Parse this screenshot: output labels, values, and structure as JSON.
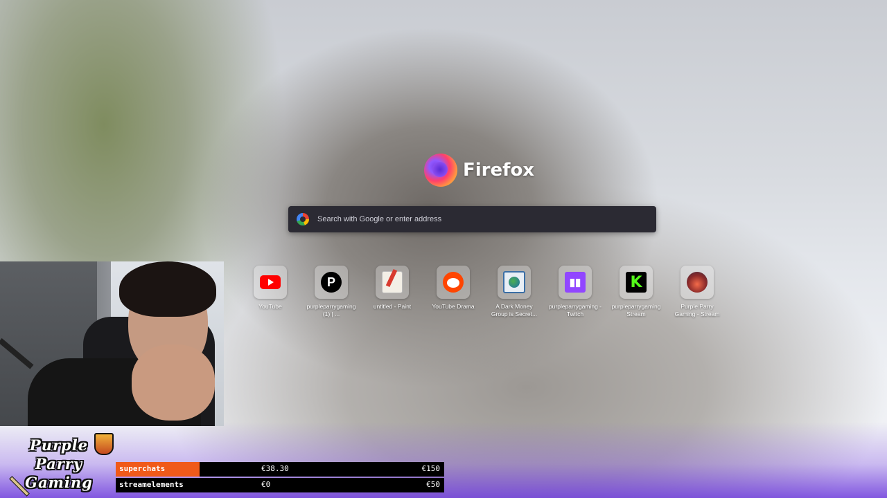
{
  "brand": {
    "name": "Firefox",
    "logo_icon": "firefox-logo-icon"
  },
  "search": {
    "placeholder": "Search with Google or enter address",
    "engine_icon": "google-g-icon"
  },
  "top_sites": [
    {
      "label": "YouTube",
      "icon": "youtube-icon"
    },
    {
      "label": "purpleparrygaming (1) | ...",
      "icon": "patreon-icon"
    },
    {
      "label": "untitled - Paint",
      "icon": "paint-icon"
    },
    {
      "label": "YouTube Drama",
      "icon": "reddit-icon"
    },
    {
      "label": "A Dark Money Group is Secret...",
      "icon": "web-page-icon"
    },
    {
      "label": "purpleparrygaming - Twitch",
      "icon": "twitch-icon"
    },
    {
      "label": "purpleparrygaming Stream",
      "icon": "kick-icon"
    },
    {
      "label": "Purple Parry Gaming - Stream",
      "icon": "purple-parry-icon"
    }
  ],
  "overlay": {
    "logo_lines": [
      "Purple",
      "Parry",
      "Gaming"
    ],
    "goals": [
      {
        "label": "superchats",
        "current": "€38.30",
        "target": "€150",
        "progress": 0.255,
        "color": "#f05a1a"
      },
      {
        "label": "streamelements",
        "current": "€0",
        "target": "€50",
        "progress": 0,
        "color": "#f05a1a"
      }
    ]
  }
}
